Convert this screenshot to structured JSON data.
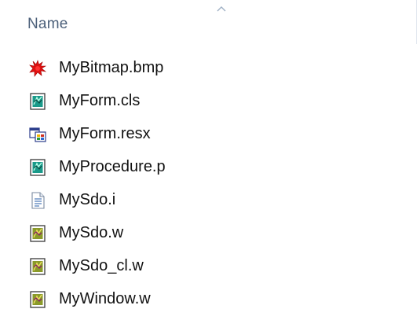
{
  "header": {
    "column_name": "Name",
    "sort": "ascending"
  },
  "files": [
    {
      "name": "MyBitmap.bmp",
      "icon": "bitmap-file-icon"
    },
    {
      "name": "MyForm.cls",
      "icon": "abl-class-file-icon"
    },
    {
      "name": "MyForm.resx",
      "icon": "resx-file-icon"
    },
    {
      "name": "MyProcedure.p",
      "icon": "abl-procedure-file-icon"
    },
    {
      "name": "MySdo.i",
      "icon": "text-document-icon"
    },
    {
      "name": "MySdo.w",
      "icon": "abl-window-file-icon"
    },
    {
      "name": "MySdo_cl.w",
      "icon": "abl-window-file-icon"
    },
    {
      "name": "MyWindow.w",
      "icon": "abl-window-file-icon"
    }
  ],
  "colors": {
    "header_text": "#4c607a",
    "file_text": "#111111"
  }
}
